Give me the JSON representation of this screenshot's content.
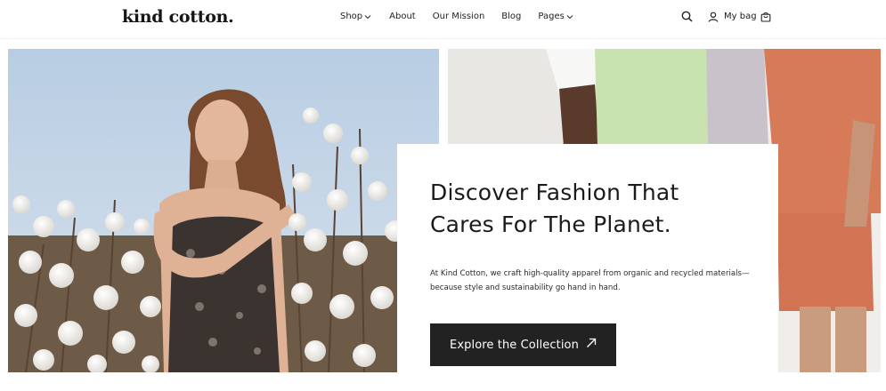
{
  "brand": {
    "logo_text": "kind cotton."
  },
  "nav": {
    "items": [
      {
        "label": "Shop",
        "has_dropdown": true
      },
      {
        "label": "About",
        "has_dropdown": false
      },
      {
        "label": "Our Mission",
        "has_dropdown": false
      },
      {
        "label": "Blog",
        "has_dropdown": false
      },
      {
        "label": "Pages",
        "has_dropdown": true
      }
    ]
  },
  "header_actions": {
    "search_icon": "search-icon",
    "user_icon": "user-icon",
    "bag_label": "My bag",
    "bag_icon": "bag-icon"
  },
  "hero": {
    "title_line1": "Discover Fashion That",
    "title_line2": "Cares For The Planet.",
    "text_line1": "At Kind Cotton, we craft high-quality apparel from organic and recycled materials—",
    "text_line2": "because style and sustainability go hand in hand.",
    "cta_label": "Explore the Collection",
    "cta_icon": "arrow-up-right-icon"
  },
  "colors": {
    "accent_dark": "#222222",
    "sky": "#b9cce0",
    "terracotta": "#d9795a"
  }
}
